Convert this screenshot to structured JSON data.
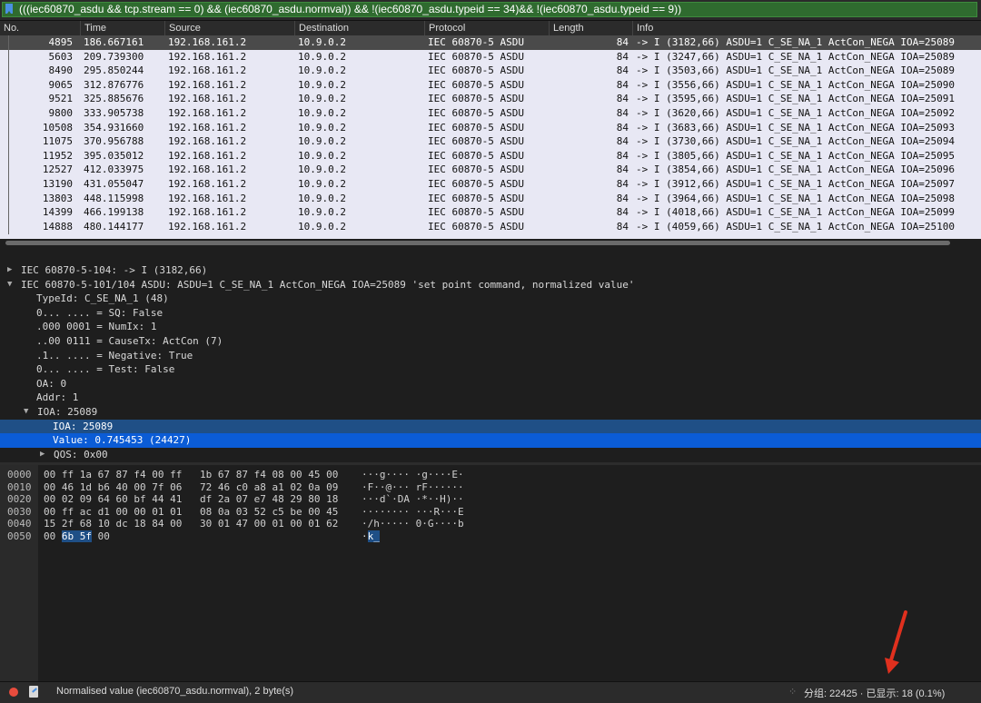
{
  "filter": {
    "expression": "(((iec60870_asdu && tcp.stream == 0) && (iec60870_asdu.normval)) && !(iec60870_asdu.typeid == 34)&& !(iec60870_asdu.typeid == 9))"
  },
  "packet_list": {
    "columns": [
      "No.",
      "Time",
      "Source",
      "Destination",
      "Protocol",
      "Length",
      "Info"
    ],
    "rows": [
      {
        "no": "4895",
        "time": "186.667161",
        "src": "192.168.161.2",
        "dst": "10.9.0.2",
        "proto": "IEC 60870-5 ASDU",
        "len": "84",
        "info": "-> I (3182,66) ASDU=1 C_SE_NA_1 ActCon_NEGA IOA=25089"
      },
      {
        "no": "5603",
        "time": "209.739300",
        "src": "192.168.161.2",
        "dst": "10.9.0.2",
        "proto": "IEC 60870-5 ASDU",
        "len": "84",
        "info": "-> I (3247,66) ASDU=1 C_SE_NA_1 ActCon_NEGA IOA=25089"
      },
      {
        "no": "8490",
        "time": "295.850244",
        "src": "192.168.161.2",
        "dst": "10.9.0.2",
        "proto": "IEC 60870-5 ASDU",
        "len": "84",
        "info": "-> I (3503,66) ASDU=1 C_SE_NA_1 ActCon_NEGA IOA=25089"
      },
      {
        "no": "9065",
        "time": "312.876776",
        "src": "192.168.161.2",
        "dst": "10.9.0.2",
        "proto": "IEC 60870-5 ASDU",
        "len": "84",
        "info": "-> I (3556,66) ASDU=1 C_SE_NA_1 ActCon_NEGA IOA=25090"
      },
      {
        "no": "9521",
        "time": "325.885676",
        "src": "192.168.161.2",
        "dst": "10.9.0.2",
        "proto": "IEC 60870-5 ASDU",
        "len": "84",
        "info": "-> I (3595,66) ASDU=1 C_SE_NA_1 ActCon_NEGA IOA=25091"
      },
      {
        "no": "9800",
        "time": "333.905738",
        "src": "192.168.161.2",
        "dst": "10.9.0.2",
        "proto": "IEC 60870-5 ASDU",
        "len": "84",
        "info": "-> I (3620,66) ASDU=1 C_SE_NA_1 ActCon_NEGA IOA=25092"
      },
      {
        "no": "10508",
        "time": "354.931660",
        "src": "192.168.161.2",
        "dst": "10.9.0.2",
        "proto": "IEC 60870-5 ASDU",
        "len": "84",
        "info": "-> I (3683,66) ASDU=1 C_SE_NA_1 ActCon_NEGA IOA=25093"
      },
      {
        "no": "11075",
        "time": "370.956788",
        "src": "192.168.161.2",
        "dst": "10.9.0.2",
        "proto": "IEC 60870-5 ASDU",
        "len": "84",
        "info": "-> I (3730,66) ASDU=1 C_SE_NA_1 ActCon_NEGA IOA=25094"
      },
      {
        "no": "11952",
        "time": "395.035012",
        "src": "192.168.161.2",
        "dst": "10.9.0.2",
        "proto": "IEC 60870-5 ASDU",
        "len": "84",
        "info": "-> I (3805,66) ASDU=1 C_SE_NA_1 ActCon_NEGA IOA=25095"
      },
      {
        "no": "12527",
        "time": "412.033975",
        "src": "192.168.161.2",
        "dst": "10.9.0.2",
        "proto": "IEC 60870-5 ASDU",
        "len": "84",
        "info": "-> I (3854,66) ASDU=1 C_SE_NA_1 ActCon_NEGA IOA=25096"
      },
      {
        "no": "13190",
        "time": "431.055047",
        "src": "192.168.161.2",
        "dst": "10.9.0.2",
        "proto": "IEC 60870-5 ASDU",
        "len": "84",
        "info": "-> I (3912,66) ASDU=1 C_SE_NA_1 ActCon_NEGA IOA=25097"
      },
      {
        "no": "13803",
        "time": "448.115998",
        "src": "192.168.161.2",
        "dst": "10.9.0.2",
        "proto": "IEC 60870-5 ASDU",
        "len": "84",
        "info": "-> I (3964,66) ASDU=1 C_SE_NA_1 ActCon_NEGA IOA=25098"
      },
      {
        "no": "14399",
        "time": "466.199138",
        "src": "192.168.161.2",
        "dst": "10.9.0.2",
        "proto": "IEC 60870-5 ASDU",
        "len": "84",
        "info": "-> I (4018,66) ASDU=1 C_SE_NA_1 ActCon_NEGA IOA=25099"
      },
      {
        "no": "14888",
        "time": "480.144177",
        "src": "192.168.161.2",
        "dst": "10.9.0.2",
        "proto": "IEC 60870-5 ASDU",
        "len": "84",
        "info": "-> I (4059,66) ASDU=1 C_SE_NA_1 ActCon_NEGA IOA=25100"
      }
    ]
  },
  "details": {
    "lines": [
      {
        "text": "IEC 60870-5-104: -> I (3182,66)",
        "expander": "collapsed"
      },
      {
        "text": "IEC 60870-5-101/104 ASDU: ASDU=1 C_SE_NA_1 ActCon_NEGA IOA=25089 'set point command, normalized value'",
        "expander": "expanded"
      },
      {
        "text": "TypeId: C_SE_NA_1 (48)",
        "expander": "none"
      },
      {
        "text": "0... .... = SQ: False",
        "expander": "none"
      },
      {
        "text": ".000 0001 = NumIx: 1",
        "expander": "none"
      },
      {
        "text": "..00 0111 = CauseTx: ActCon (7)",
        "expander": "none"
      },
      {
        "text": ".1.. .... = Negative: True",
        "expander": "none"
      },
      {
        "text": "0... .... = Test: False",
        "expander": "none"
      },
      {
        "text": "OA: 0",
        "expander": "none"
      },
      {
        "text": "Addr: 1",
        "expander": "none"
      },
      {
        "text": "IOA: 25089",
        "expander": "expanded"
      },
      {
        "text": "IOA: 25089",
        "expander": "none"
      },
      {
        "text": "Value: 0.745453 (24427)",
        "expander": "none"
      },
      {
        "text": "QOS: 0x00",
        "expander": "collapsed"
      }
    ]
  },
  "bytes": {
    "rows": [
      {
        "offset": "0000",
        "hex1": "00 ff 1a 67 87 f4 00 ff",
        "hex2": "1b 67 87 f4 08 00 45 00",
        "ascii": "···g···· ·g····E·"
      },
      {
        "offset": "0010",
        "hex1": "00 46 1d b6 40 00 7f 06",
        "hex2": "72 46 c0 a8 a1 02 0a 09",
        "ascii": "·F··@··· rF······"
      },
      {
        "offset": "0020",
        "hex1": "00 02 09 64 60 bf 44 41",
        "hex2": "df 2a 07 e7 48 29 80 18",
        "ascii": "···d`·DA ·*··H)··"
      },
      {
        "offset": "0030",
        "hex1": "00 ff ac d1 00 00 01 01",
        "hex2": "08 0a 03 52 c5 be 00 45",
        "ascii": "········ ···R···E"
      },
      {
        "offset": "0040",
        "hex1": "15 2f 68 10 dc 18 84 00",
        "hex2": "30 01 47 00 01 00 01 62",
        "ascii": "·/h····· 0·G····b"
      },
      {
        "offset": "0050",
        "hex1_pre": "00 ",
        "hex1_sel": "6b 5f",
        "hex1_post": " 00",
        "hex2": "",
        "ascii_pre": "·",
        "ascii_sel": "k_",
        "ascii_post": ""
      }
    ]
  },
  "status": {
    "field_text": "Normalised value (iec60870_asdu.normval), 2 byte(s)",
    "counts": "分组: 22425 · 已显示: 18 (0.1%)",
    "separator": "⁘"
  },
  "colors": {
    "filter_valid": "#2f6b2f",
    "selection": "#0b5cd6",
    "row_bg": "#e8e8f4",
    "annotation_arrow": "#e0301e"
  }
}
